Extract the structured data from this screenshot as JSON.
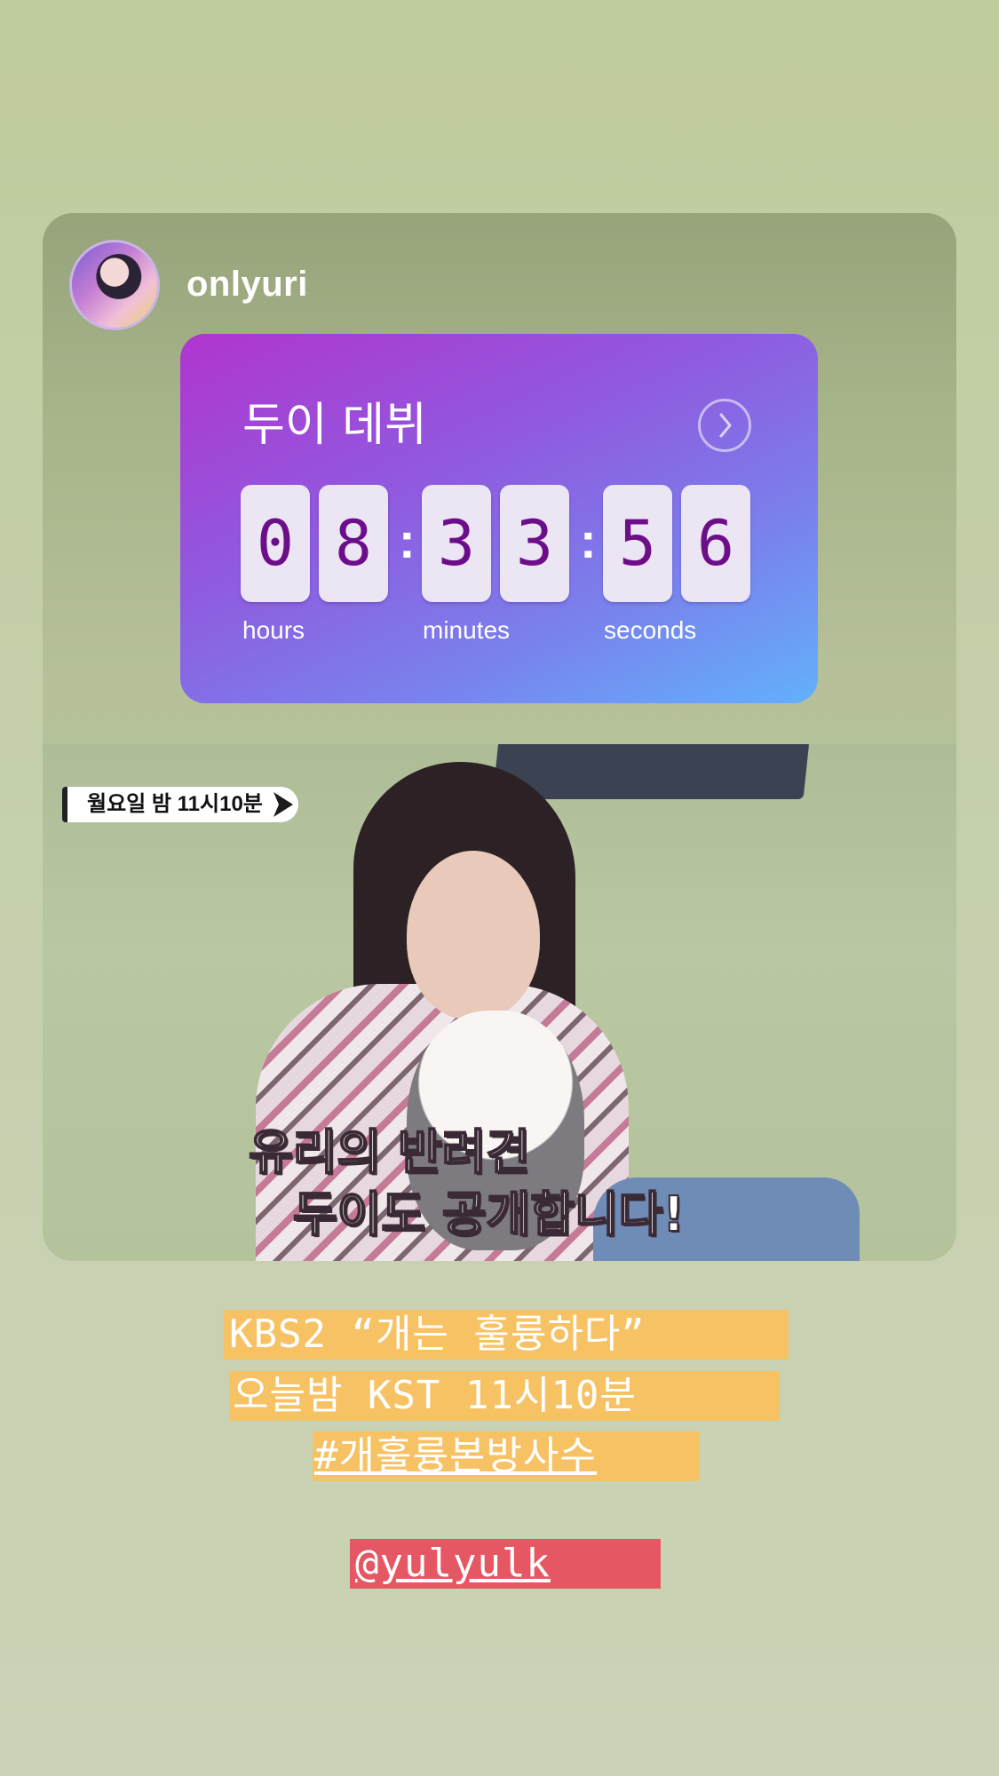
{
  "story": {
    "username": "onlyuri",
    "countdown": {
      "title": "두이 데뷔",
      "digits": [
        "0",
        "8",
        "3",
        "3",
        "5",
        "6"
      ],
      "separator": ":",
      "units": [
        "hours",
        "minutes",
        "seconds"
      ]
    },
    "video": {
      "tag": "월요일 밤 11시10분",
      "caption_line1": "유리의 반려견",
      "caption_line2": "두이도 공개합니다!"
    }
  },
  "overlay_text": {
    "line1": "KBS2 “개는 훌륭하다”",
    "line2": "오늘밤 KST 11시10분",
    "hashtag": "#개훌륭본방사수",
    "mention": "@yulyulk"
  },
  "colors": {
    "highlight_yellow": "#f7c264",
    "highlight_red": "#e55763",
    "digit_color": "#6c0e8a",
    "background": "#c1cca2"
  }
}
